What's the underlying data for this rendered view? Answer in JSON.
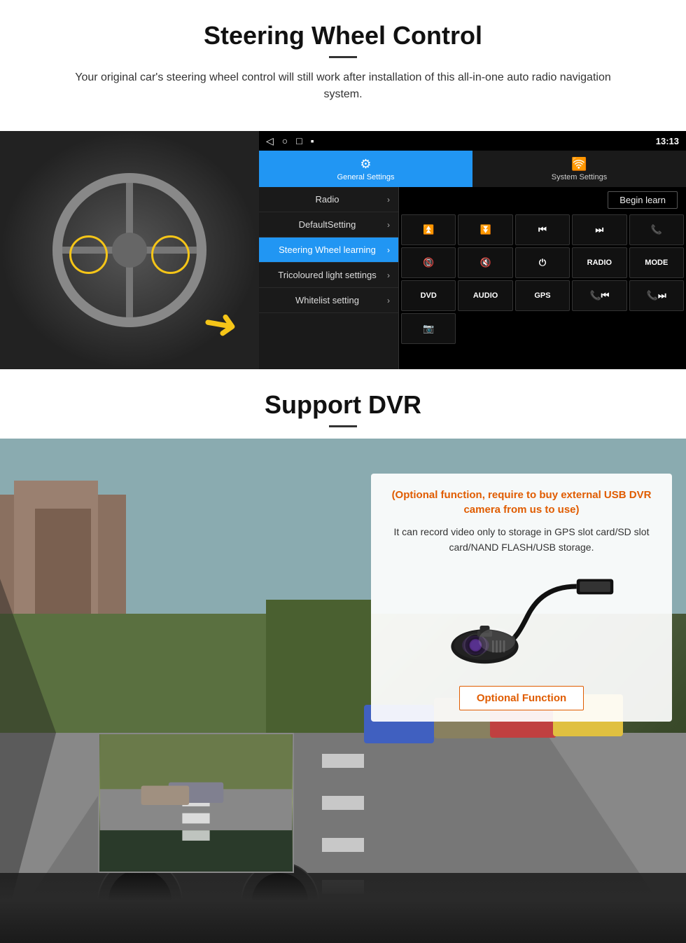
{
  "steering": {
    "title": "Steering Wheel Control",
    "description": "Your original car's steering wheel control will still work after installation of this all-in-one auto radio navigation system.",
    "android_ui": {
      "status_bar": {
        "back_icon": "◁",
        "home_icon": "○",
        "square_icon": "□",
        "menu_icon": "▪",
        "signal_icon": "▾",
        "wifi_icon": "▾",
        "time": "13:13"
      },
      "tabs": [
        {
          "id": "general",
          "label": "General Settings",
          "icon": "⚙",
          "active": true
        },
        {
          "id": "system",
          "label": "System Settings",
          "icon": "⚡",
          "active": false
        }
      ],
      "menu_items": [
        {
          "id": "radio",
          "label": "Radio",
          "active": false
        },
        {
          "id": "default",
          "label": "DefaultSetting",
          "active": false
        },
        {
          "id": "steering",
          "label": "Steering Wheel learning",
          "active": true
        },
        {
          "id": "tricoloured",
          "label": "Tricoloured light settings",
          "active": false
        },
        {
          "id": "whitelist",
          "label": "Whitelist setting",
          "active": false
        }
      ],
      "begin_learn_label": "Begin learn",
      "control_buttons": [
        {
          "id": "vol_up",
          "label": "▐+",
          "type": "icon"
        },
        {
          "id": "vol_down",
          "label": "▐−",
          "type": "icon"
        },
        {
          "id": "prev_track",
          "label": "⏮",
          "type": "icon"
        },
        {
          "id": "next_track",
          "label": "⏭",
          "type": "icon"
        },
        {
          "id": "phone",
          "label": "✆",
          "type": "icon"
        },
        {
          "id": "hang_up",
          "label": "📵",
          "type": "icon"
        },
        {
          "id": "mute",
          "label": "🔇",
          "type": "icon"
        },
        {
          "id": "power",
          "label": "⏻",
          "type": "icon"
        },
        {
          "id": "radio_btn",
          "label": "RADIO",
          "type": "text"
        },
        {
          "id": "mode_btn",
          "label": "MODE",
          "type": "text"
        },
        {
          "id": "dvd_btn",
          "label": "DVD",
          "type": "text"
        },
        {
          "id": "audio_btn",
          "label": "AUDIO",
          "type": "text"
        },
        {
          "id": "gps_btn",
          "label": "GPS",
          "type": "text"
        },
        {
          "id": "phone_prev",
          "label": "📞⏮",
          "type": "icon"
        },
        {
          "id": "phone_next",
          "label": "📞⏭",
          "type": "icon"
        },
        {
          "id": "extra",
          "label": "📷",
          "type": "icon"
        }
      ]
    }
  },
  "dvr": {
    "title": "Support DVR",
    "optional_note": "(Optional function, require to buy external USB DVR camera from us to use)",
    "description": "It can record video only to storage in GPS slot card/SD slot card/NAND FLASH/USB storage.",
    "optional_button_label": "Optional Function"
  }
}
